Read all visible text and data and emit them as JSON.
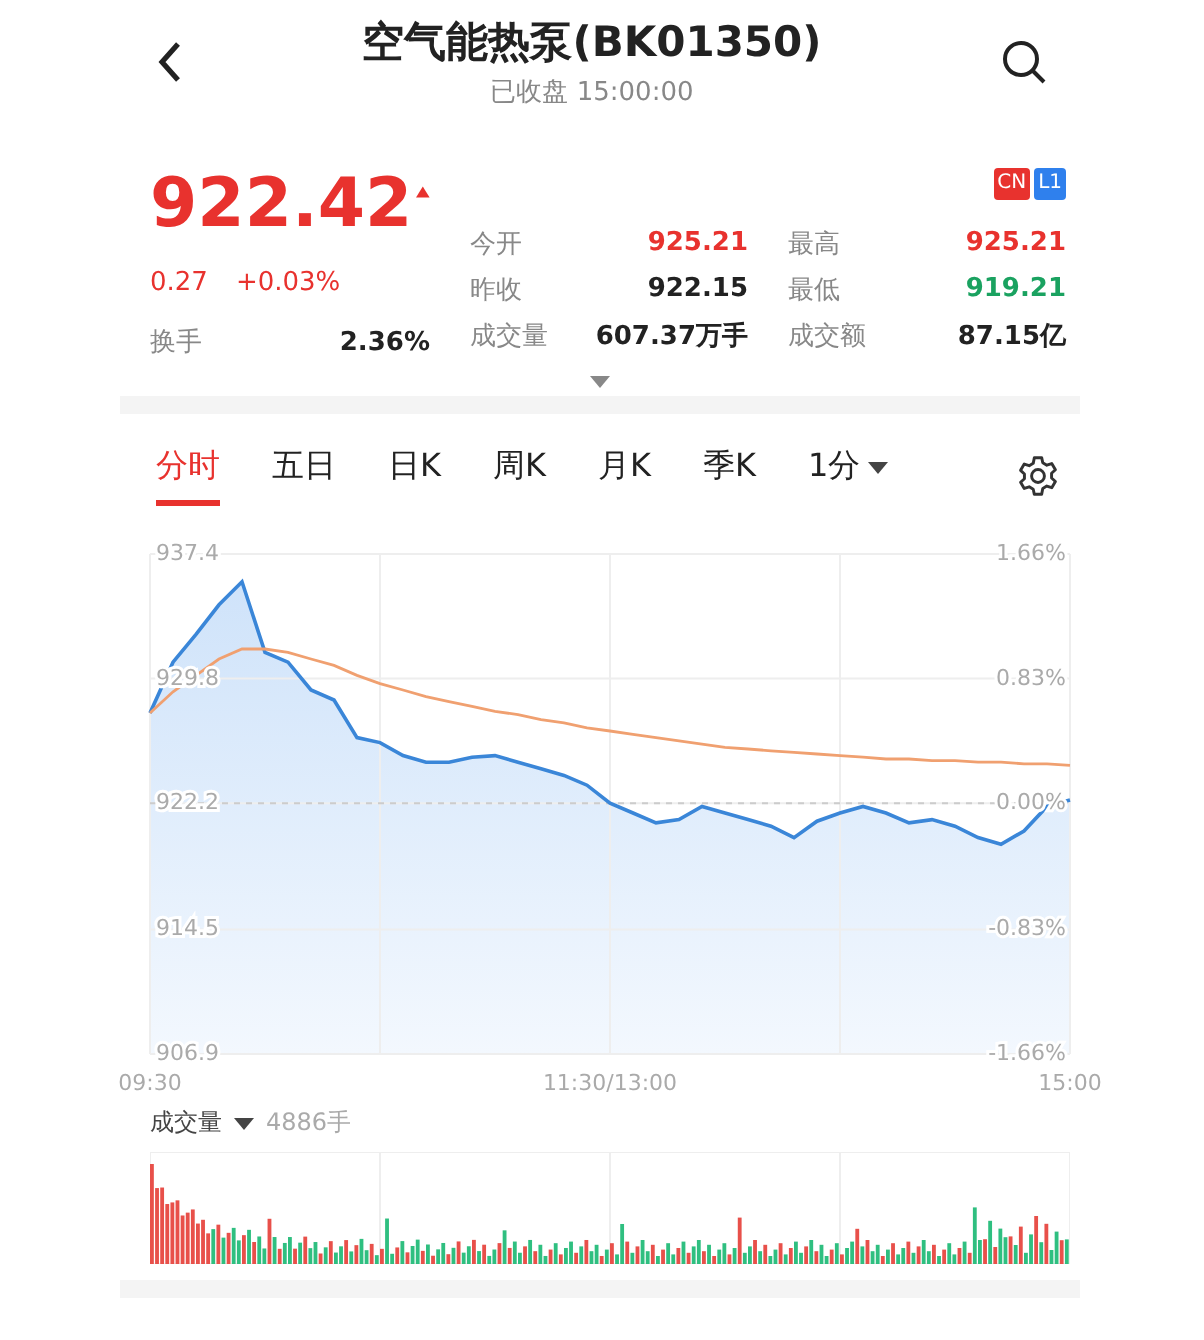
{
  "header": {
    "title": "空气能热泵(BK01350)",
    "subtitle": "已收盘 15:00:00"
  },
  "quote": {
    "price": "922.42",
    "color": "#e8322e",
    "change": "0.27",
    "change_pct": "+0.03%",
    "badges": [
      {
        "text": "CN",
        "color": "#e8322e"
      },
      {
        "text": "L1",
        "color": "#2f80ed"
      }
    ],
    "turnover": {
      "label": "换手",
      "value": "2.36%"
    },
    "stats": [
      {
        "label": "今开",
        "value": "925.21",
        "color": "#e8322e"
      },
      {
        "label": "最高",
        "value": "925.21",
        "color": "#e8322e"
      },
      {
        "label": "昨收",
        "value": "922.15",
        "color": "#222222"
      },
      {
        "label": "最低",
        "value": "919.21",
        "color": "#1aa260"
      },
      {
        "label": "成交量",
        "value": "607.37万手",
        "color": "#222222"
      },
      {
        "label": "成交额",
        "value": "87.15亿",
        "color": "#222222"
      }
    ]
  },
  "tabs": [
    {
      "label": "分时",
      "selected": true,
      "kind": "tab"
    },
    {
      "label": "五日",
      "selected": false,
      "kind": "tab"
    },
    {
      "label": "日K",
      "selected": false,
      "kind": "tab"
    },
    {
      "label": "周K",
      "selected": false,
      "kind": "tab"
    },
    {
      "label": "月K",
      "selected": false,
      "kind": "tab"
    },
    {
      "label": "季K",
      "selected": false,
      "kind": "tab"
    },
    {
      "label": "1分",
      "selected": false,
      "kind": "dropdown"
    }
  ],
  "chart": {
    "percent_labels": [
      "1.66%",
      "0.83%",
      "0.00%",
      "-0.83%",
      "-1.66%"
    ],
    "chart_data": {
      "type": "area",
      "grid": true,
      "ref_lines": [
        {
          "axis": "y",
          "value": 922.2
        }
      ],
      "categories": [
        "09:30",
        null,
        null,
        null,
        null,
        null,
        null,
        null,
        null,
        null,
        null,
        null,
        null,
        null,
        null,
        null,
        null,
        null,
        null,
        null,
        "11:30/13:00",
        null,
        null,
        null,
        null,
        null,
        null,
        null,
        null,
        null,
        null,
        null,
        null,
        null,
        null,
        null,
        null,
        null,
        null,
        null,
        "15:00"
      ],
      "series": [
        {
          "type": "area",
          "color": "#3a86d8",
          "values": [
            927.7,
            930.8,
            932.5,
            934.3,
            935.7,
            931.4,
            930.8,
            929.1,
            928.5,
            926.2,
            925.9,
            925.1,
            924.7,
            924.7,
            925.0,
            925.1,
            924.7,
            924.3,
            923.9,
            923.3,
            922.2,
            921.6,
            921.0,
            921.2,
            922.0,
            921.6,
            921.2,
            920.8,
            920.1,
            921.1,
            921.6,
            922.0,
            921.6,
            921.0,
            921.2,
            920.8,
            920.1,
            919.7,
            920.5,
            922.0,
            922.4
          ]
        },
        {
          "type": "line",
          "color": "#f0a070",
          "values": [
            927.7,
            929.0,
            930.0,
            931.0,
            931.6,
            931.6,
            931.4,
            931.0,
            930.6,
            930.0,
            929.5,
            929.1,
            928.7,
            928.4,
            928.1,
            927.8,
            927.6,
            927.3,
            927.1,
            926.8,
            926.6,
            926.4,
            926.2,
            926.0,
            925.8,
            925.6,
            925.5,
            925.4,
            925.3,
            925.2,
            925.1,
            925.0,
            924.9,
            924.9,
            924.8,
            924.8,
            924.7,
            924.7,
            924.6,
            924.6,
            924.5
          ]
        }
      ],
      "ylim": [
        906.9,
        937.4
      ],
      "yticks": [
        937.4,
        929.8,
        922.2,
        914.5,
        906.9
      ]
    }
  },
  "volume": {
    "label": "成交量",
    "value": "4886手"
  }
}
